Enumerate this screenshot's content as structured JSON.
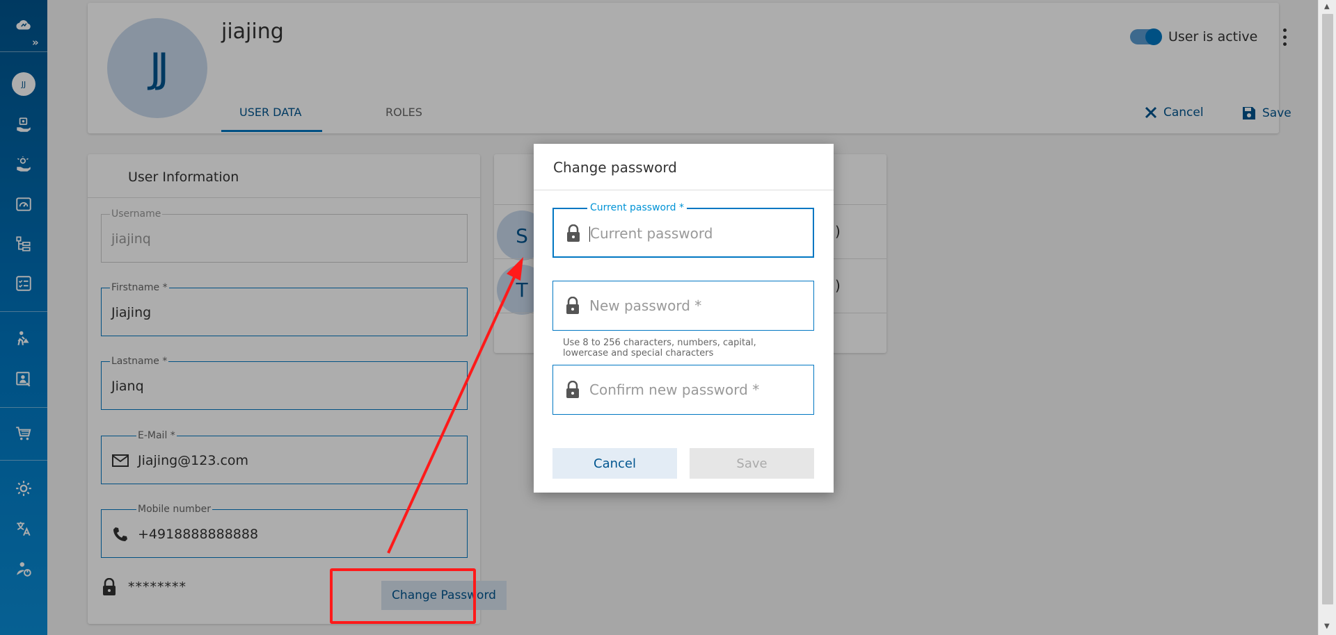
{
  "sidebar": {
    "avatar_initials": "JJ",
    "expand_glyph": "»",
    "icons": [
      "cloud-logo-icon",
      "user-avatar",
      "hand-gear-icon",
      "hand-bulb-icon",
      "gauge-icon",
      "tree-list-icon",
      "checklist-icon",
      "person-sign-icon",
      "monitor-person-icon",
      "cart-icon",
      "brightness-icon",
      "translate-icon",
      "person-power-icon"
    ]
  },
  "header": {
    "avatar_initials": "JJ",
    "user_name": "jiajing",
    "tabs": [
      {
        "label": "USER DATA"
      },
      {
        "label": "ROLES"
      }
    ],
    "active_label": "User is active",
    "cancel_label": "Cancel",
    "save_label": "Save"
  },
  "user_info": {
    "title": "User Information",
    "username_label": "Username",
    "username_value": "jiajinq",
    "firstname_label": "Firstname *",
    "firstname_value": "Jiajing",
    "lastname_label": "Lastname *",
    "lastname_value": "Jianq",
    "email_label": "E-Mail *",
    "email_value": "Jiajing@123.com",
    "mobile_label": "Mobile number",
    "mobile_value": "+4918888888888",
    "password_mask": "********",
    "change_password_label": "Change Password"
  },
  "roles": {
    "rows": [
      {
        "initial": "S",
        "suffix": ")"
      },
      {
        "initial": "T",
        "suffix": ")"
      }
    ]
  },
  "dialog": {
    "title": "Change password",
    "current_label": "Current password *",
    "current_placeholder": "Current password",
    "new_placeholder": "New password *",
    "hint": "Use 8 to 256 characters, numbers, capital, lowercase and special characters",
    "confirm_placeholder": "Confirm new password *",
    "cancel_label": "Cancel",
    "save_label": "Save"
  },
  "colors": {
    "brand": "#00558f",
    "accent": "#0077c2",
    "annotation_red": "#ff1a1a"
  }
}
